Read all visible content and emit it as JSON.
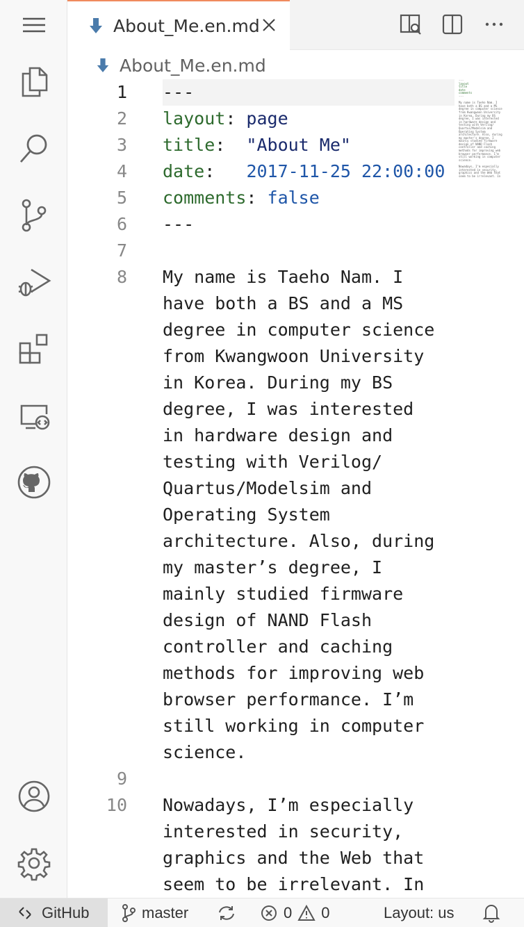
{
  "tab": {
    "title": "About_Me.en.md"
  },
  "breadcrumb": {
    "file": "About_Me.en.md"
  },
  "editor": {
    "line_numbers": [
      "1",
      "2",
      "3",
      "4",
      "5",
      "6",
      "7",
      "8",
      "9",
      "10"
    ],
    "front_matter": {
      "delim": "---",
      "layout_key": "layout",
      "layout_val": "page",
      "title_key": "title",
      "title_val": "\"About Me\"",
      "date_key": "date",
      "date_val": "2017-11-25 22:00:00",
      "comments_key": "comments",
      "comments_val": "false"
    },
    "paragraph1_lines": [
      "My name is Taeho Nam. I",
      "have both a BS and a MS",
      "degree in computer science",
      "from Kwangwoon University",
      "in Korea. During my BS",
      "degree, I was interested",
      "in hardware design and",
      "testing with Verilog/",
      "Quartus/Modelsim and",
      "Operating System",
      "architecture. Also, during",
      "my master’s degree, I",
      "mainly studied firmware",
      "design of NAND Flash",
      "controller and caching",
      "methods for improving web",
      "browser performance. I’m",
      "still working in computer",
      "science."
    ],
    "paragraph2_lines": [
      "Nowadays, I’m especially",
      "interested in security,",
      "graphics and the Web that",
      "seem to be irrelevant. In"
    ]
  },
  "status_bar": {
    "remote": "GitHub",
    "branch": "master",
    "errors": "0",
    "warnings": "0",
    "layout": "Layout: us"
  }
}
